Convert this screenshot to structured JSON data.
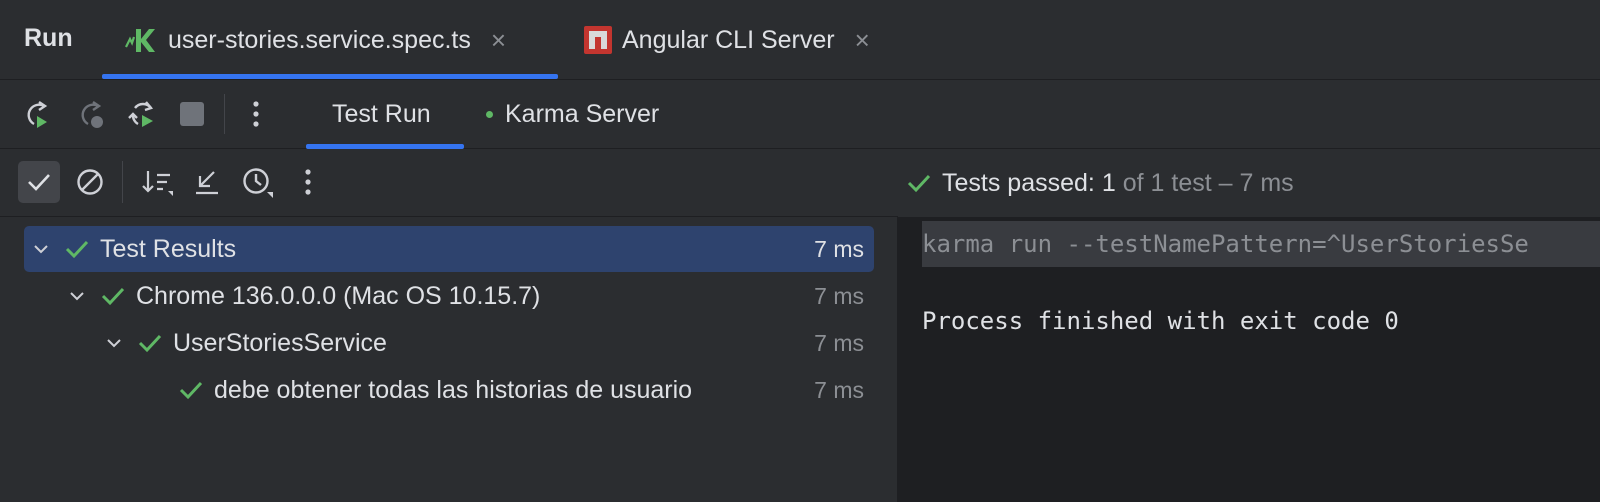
{
  "header": {
    "title": "Run",
    "tabs": [
      {
        "label": "user-stories.service.spec.ts",
        "icon": "karma-icon",
        "close": "×"
      },
      {
        "label": "Angular CLI Server",
        "icon": "angular-cli-icon",
        "close": "×"
      }
    ]
  },
  "toolbar": {
    "icons": [
      "rerun-icon",
      "rerun-failed-icon",
      "toggle-auto-test-icon",
      "stop-icon",
      "more-options-icon"
    ],
    "subtabs": [
      {
        "label": "Test Run"
      },
      {
        "label": "Karma Server",
        "indicator": "running"
      }
    ]
  },
  "test_toolbar": {
    "icons": [
      "show-passed-icon",
      "show-ignored-icon",
      "sort-icon",
      "collapse-icon",
      "test-history-icon",
      "more-options-icon"
    ]
  },
  "status": {
    "prefix": "Tests passed:",
    "count": "1",
    "rest": "of 1 test – 7 ms"
  },
  "tree": [
    {
      "label": "Test Results",
      "duration": "7 ms",
      "level": 0,
      "expanded": true,
      "selected": true
    },
    {
      "label": "Chrome 136.0.0.0 (Mac OS 10.15.7)",
      "duration": "7 ms",
      "level": 1,
      "expanded": true
    },
    {
      "label": "UserStoriesService",
      "duration": "7 ms",
      "level": 2,
      "expanded": true
    },
    {
      "label": "debe obtener todas las historias de usuario",
      "duration": "7 ms",
      "level": 3
    }
  ],
  "console": {
    "command": "karma run --testNamePattern=^UserStoriesSe",
    "output": "Process finished with exit code 0"
  },
  "colors": {
    "background": "#2b2d30",
    "console_bg": "#1e1f22",
    "accent": "#3574f0",
    "success": "#5fb865",
    "selection": "#2e436e"
  }
}
